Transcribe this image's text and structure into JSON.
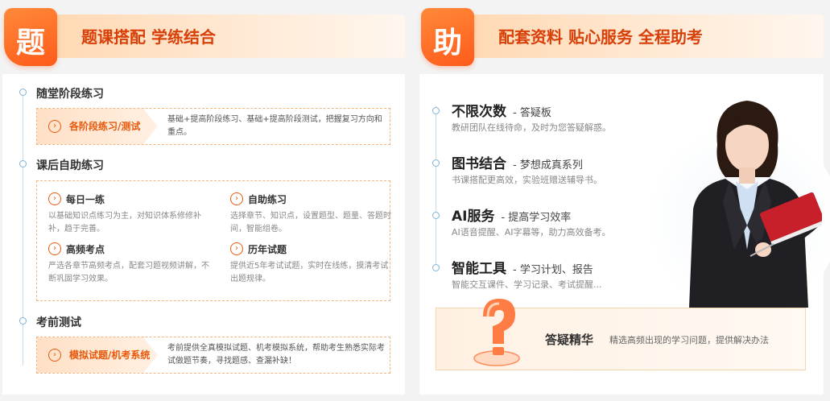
{
  "left_panel": {
    "badge": "题",
    "title": "题课搭配 学练结合",
    "sections": [
      {
        "title": "随堂阶段练习"
      },
      {
        "title": "课后自助练习"
      },
      {
        "title": "考前测试"
      }
    ],
    "stage_row": {
      "label": "各阶段练习/测试",
      "desc": "基础+提高阶段练习、基础+提高阶段测试，把握复习方向和重点。"
    },
    "self_items": [
      {
        "title": "每日一练",
        "desc": "以基础知识点练习为主，对知识体系修修补补，趋于完善。"
      },
      {
        "title": "自助练习",
        "desc": "选择章节、知识点，设置题型、题量、答题时间，智能组卷。"
      },
      {
        "title": "高频考点",
        "desc": "严选各章节高频考点，配套习题视频讲解，不断巩固学习效果。"
      },
      {
        "title": "历年试题",
        "desc": "提供近5年考试试题，实时在线练，摸清考试出题规律。"
      }
    ],
    "exam_row": {
      "label": "模拟试题/机考系统",
      "desc": "考前提供全真模拟试题、机考模拟系统，帮助考生熟悉实际考试做题节奏，寻找题感、查漏补缺！"
    }
  },
  "right_panel": {
    "badge": "助",
    "title": "配套资料 贴心服务 全程助考",
    "features": [
      {
        "title": "不限次数",
        "sub": "- 答疑板",
        "desc": "教研团队在线待命，及时为您答疑解惑。"
      },
      {
        "title": "图书结合",
        "sub": "- 梦想成真系列",
        "desc": "书课搭配更高效，实验班赠送辅导书。"
      },
      {
        "title": "AI服务",
        "sub": "- 提高学习效率",
        "desc": "AI语音提醒、AI字幕等，助力高效备考。"
      },
      {
        "title": "智能工具",
        "sub": "- 学习计划、报告",
        "desc": "智能交互课件、学习记录、考试提醒..."
      }
    ],
    "qa": {
      "title": "答疑精华",
      "desc": "精选高频出现的学习问题，提供解决办法"
    }
  },
  "icons": {
    "arrow": "arrow-right-circle-icon",
    "question": "question-mark-3d-icon",
    "teacher": "teacher-illustration"
  },
  "colors": {
    "accent": "#e8590c",
    "badge": "#ff6a1f",
    "header_bg": "#ffe2c6"
  }
}
